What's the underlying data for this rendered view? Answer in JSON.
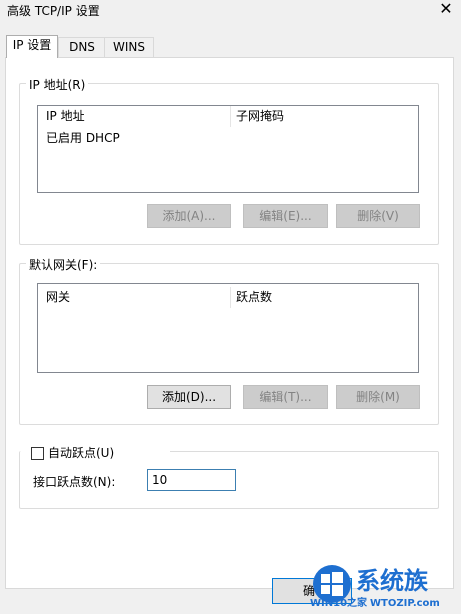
{
  "window": {
    "title": "高级 TCP/IP 设置",
    "close_glyph": "✕"
  },
  "tabs": [
    {
      "label": "IP 设置",
      "active": true
    },
    {
      "label": "DNS",
      "active": false
    },
    {
      "label": "WINS",
      "active": false
    }
  ],
  "ip_section": {
    "legend": "IP 地址(R)",
    "columns": [
      "IP 地址",
      "子网掩码"
    ],
    "rows": [
      [
        "已启用 DHCP",
        ""
      ]
    ],
    "buttons": {
      "add": "添加(A)...",
      "edit": "编辑(E)...",
      "delete": "删除(V)"
    }
  },
  "gateway_section": {
    "legend": "默认网关(F):",
    "columns": [
      "网关",
      "跃点数"
    ],
    "rows": [],
    "buttons": {
      "add": "添加(D)...",
      "edit": "编辑(T)...",
      "delete": "删除(M)"
    }
  },
  "metric_section": {
    "auto_label": "自动跃点(U)",
    "auto_checked": false,
    "interface_label": "接口跃点数(N):",
    "interface_value": "10"
  },
  "footer": {
    "ok_label_visible": "确"
  },
  "watermark": {
    "brand": "系统族",
    "url": "WTOZIP.com",
    "prefix": "WIN10之家"
  },
  "colors": {
    "panel_bg": "#ffffff",
    "window_bg": "#f0f0f0",
    "disabled_btn": "#cccccc",
    "watermark_blue": "#1e6fd0"
  }
}
